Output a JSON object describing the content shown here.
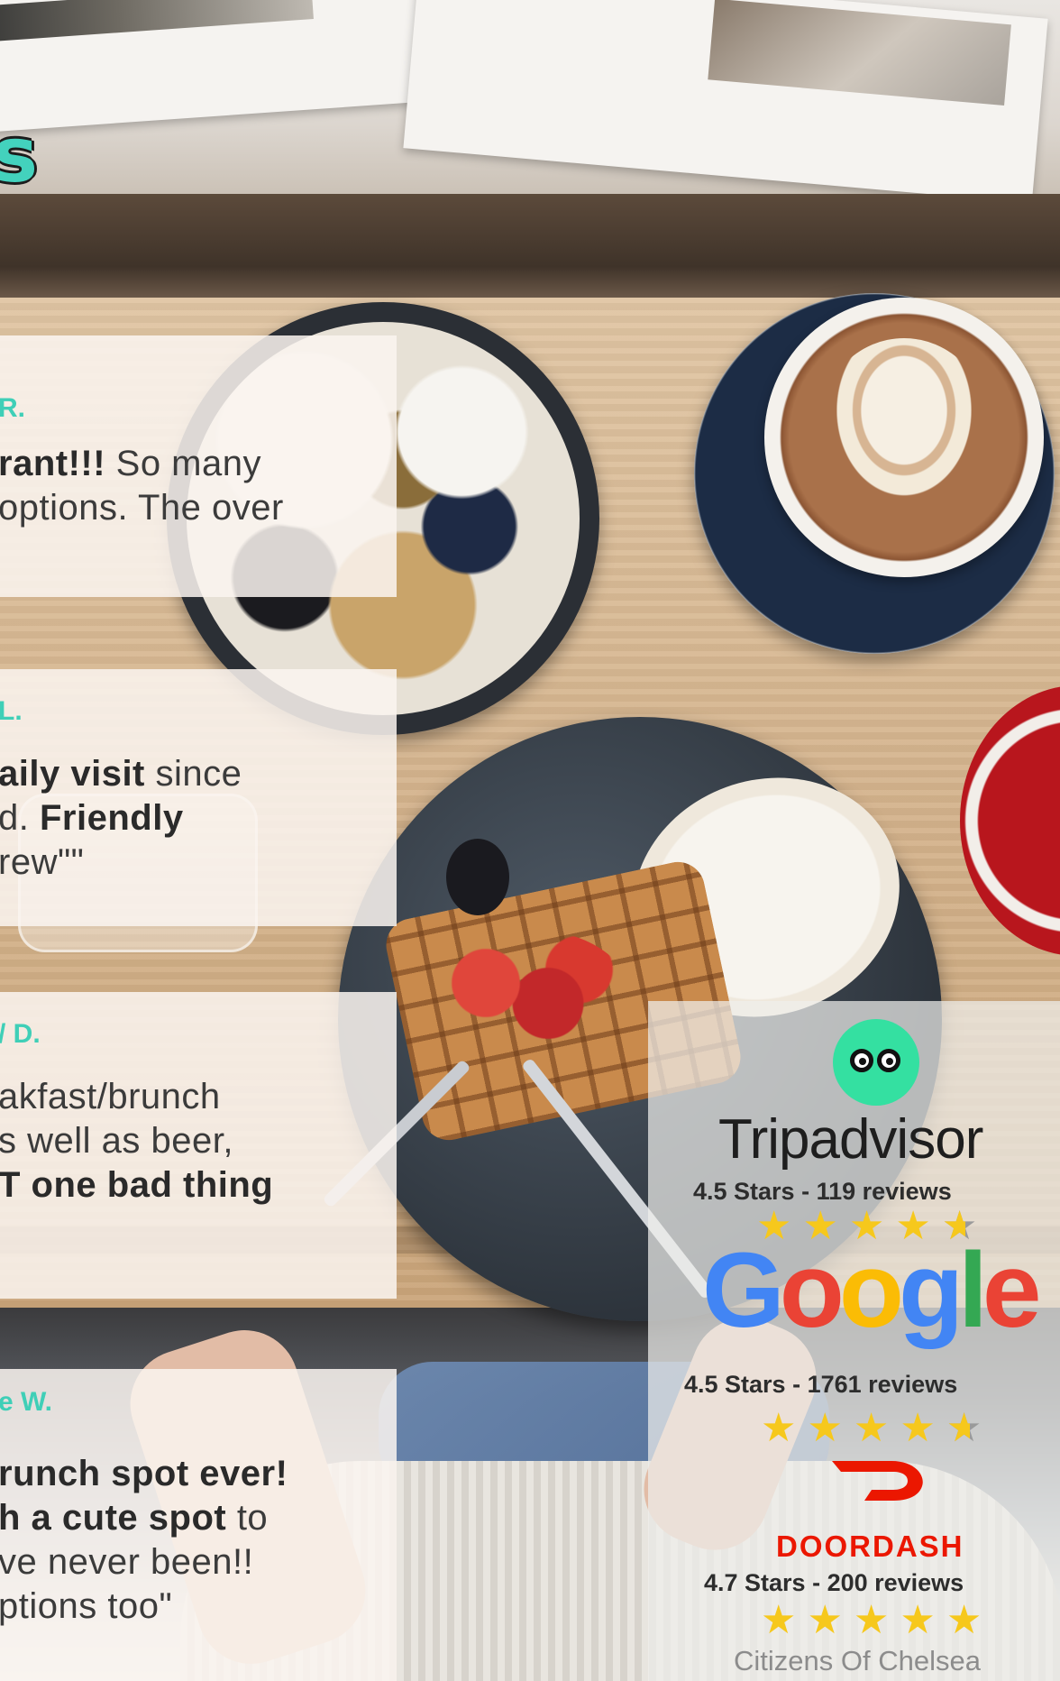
{
  "header": {
    "title_fragment": "s"
  },
  "reviews": [
    {
      "author": "R.",
      "lines": [
        [
          {
            "t": "rant!!!",
            "b": true
          },
          {
            "t": " So many",
            "b": false
          }
        ],
        [
          {
            "t": "options. The over",
            "b": false
          }
        ]
      ]
    },
    {
      "author": "L.",
      "lines": [
        [
          {
            "t": "aily visit",
            "b": true
          },
          {
            "t": " since",
            "b": false
          }
        ],
        [
          {
            "t": "d. ",
            "b": false
          },
          {
            "t": "Friendly",
            "b": true
          }
        ],
        [
          {
            "t": "rew\"\"",
            "b": false
          }
        ]
      ]
    },
    {
      "author": "/ D.",
      "lines": [
        [
          {
            "t": "akfast/brunch",
            "b": false
          }
        ],
        [
          {
            "t": "s well as beer,",
            "b": false
          }
        ],
        [
          {
            "t": "T one bad thing",
            "b": true
          }
        ]
      ]
    },
    {
      "author": "e W.",
      "lines": [
        [
          {
            "t": "runch spot ever!",
            "b": true
          }
        ],
        [
          {
            "t": "h a cute spot",
            "b": true
          },
          {
            "t": " to",
            "b": false
          }
        ],
        [
          {
            "t": "ve never been!!",
            "b": false
          }
        ],
        [
          {
            "t": "ptions too\"",
            "b": false
          }
        ]
      ]
    }
  ],
  "ratings": {
    "tripadvisor": {
      "name": "Tripadvisor",
      "summary": "4.5 Stars - 119 reviews",
      "stars": 4.5
    },
    "google": {
      "letters": [
        "G",
        "o",
        "o",
        "g",
        "l",
        "e"
      ],
      "summary": "4.5 Stars - 1761 reviews",
      "stars": 4.5
    },
    "doordash": {
      "name": "DOORDASH",
      "summary": "4.7 Stars - 200 reviews",
      "stars": 5
    },
    "footer_brand": "Citizens Of Chelsea"
  },
  "colors": {
    "accent_teal": "#3fcfb7",
    "star_yellow": "#f6c81c",
    "doordash_red": "#eb1700",
    "tripadvisor_green": "#34e0a1"
  },
  "icons": [
    "tripadvisor-owl-icon",
    "doordash-icon",
    "star-icon"
  ]
}
